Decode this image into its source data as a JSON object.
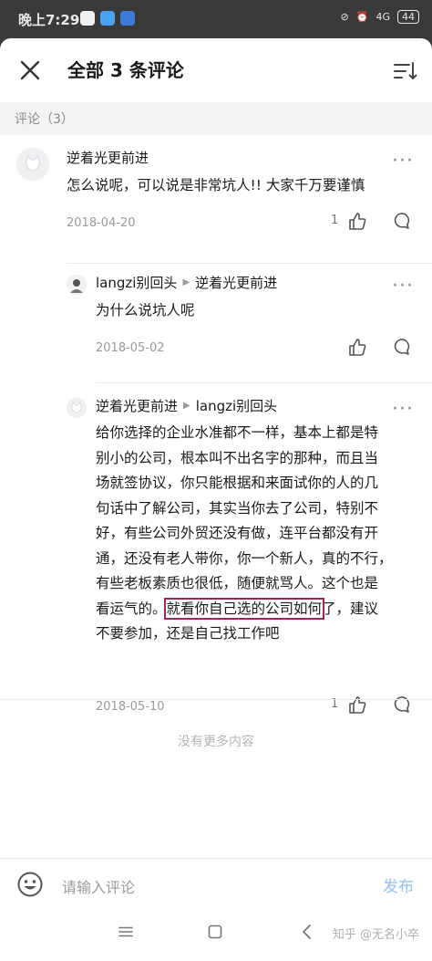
{
  "status_bar": {
    "time": "晚上7:29",
    "battery": "44",
    "signal": "4G"
  },
  "header": {
    "title": "全部 3 条评论"
  },
  "section": {
    "label": "评论（3）"
  },
  "comments": [
    {
      "author": "逆着光更前进",
      "reply_to": "",
      "text": "怎么说呢，可以说是非常坑人!! 大家千万要谨慎",
      "date": "2018-04-20",
      "likes": "1"
    },
    {
      "author": "langzi别回头",
      "reply_to": "逆着光更前进",
      "text": "为什么说坑人呢",
      "date": "2018-05-02",
      "likes": ""
    },
    {
      "author": "逆着光更前进",
      "reply_to": "langzi别回头",
      "text_lines": [
        "给你选择的企业水准都不一样，基本上都是特",
        "别小的公司，根本叫不出名字的那种，而且当",
        "场就签协议，你只能根据和来面试你的人的几",
        "句话中了解公司，其实当你去了公司，特别不",
        "好，有些公司外贸还没有做，连平台都没有开",
        "通，还没有老人带你，你一个新人，真的不行，",
        "有些老板素质也很低，随便就骂人。这个也是"
      ],
      "text_last_pre": "看运气的。",
      "text_highlight": "就看你自己选的公司如何",
      "text_last_post": "了，建议",
      "text_tail": "不要参加，还是自己找工作吧",
      "date": "2018-05-10",
      "likes": "1"
    }
  ],
  "footer": {
    "no_more": "没有更多内容"
  },
  "input_bar": {
    "placeholder": "请输入评论",
    "send_label": "发布"
  },
  "nav": {
    "watermark": "知乎 @无名小卒"
  },
  "colors": {
    "highlight_box": "#a3245a",
    "send_disabled": "#8fc1f0"
  }
}
